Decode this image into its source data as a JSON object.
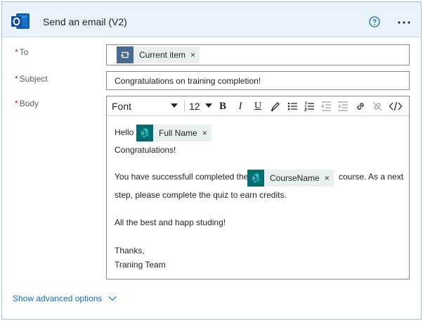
{
  "header": {
    "title": "Send an email (V2)",
    "app_icon": "outlook-icon",
    "help_icon": "help-circle-icon",
    "more_icon": "more-dots-icon",
    "accent": "#0f6cbd",
    "background": "#eaf3fc"
  },
  "fields": {
    "to": {
      "required_marker": "*",
      "label": "To",
      "token": {
        "label": "Current item",
        "icon": "loop-icon",
        "close": "×",
        "icon_color": "#486991"
      }
    },
    "subject": {
      "required_marker": "*",
      "label": "Subject",
      "value": "Congratulations on training completion!"
    },
    "body": {
      "required_marker": "*",
      "label": "Body",
      "toolbar": {
        "font": "Font",
        "size": "12",
        "bold": "B",
        "italic": "I",
        "underline": "U"
      },
      "lines": {
        "hello": "Hello",
        "congrats": "Congratulations!",
        "completed_prefix": "You have successfull completed the",
        "completed_suffix": "course. As a next",
        "next_step": "step, please complete the quiz to earn credits.",
        "best": "All the best and happ studing!",
        "thanks": "Thanks,",
        "team": "Traning Team"
      },
      "tokens": {
        "full_name": {
          "label": "Full Name",
          "icon": "sharepoint-icon",
          "close": "×"
        },
        "course_name": {
          "label": "CourseName",
          "icon": "sharepoint-icon",
          "close": "×"
        },
        "icon_color": "#036c70"
      }
    }
  },
  "footer": {
    "advanced_label": "Show advanced options"
  }
}
